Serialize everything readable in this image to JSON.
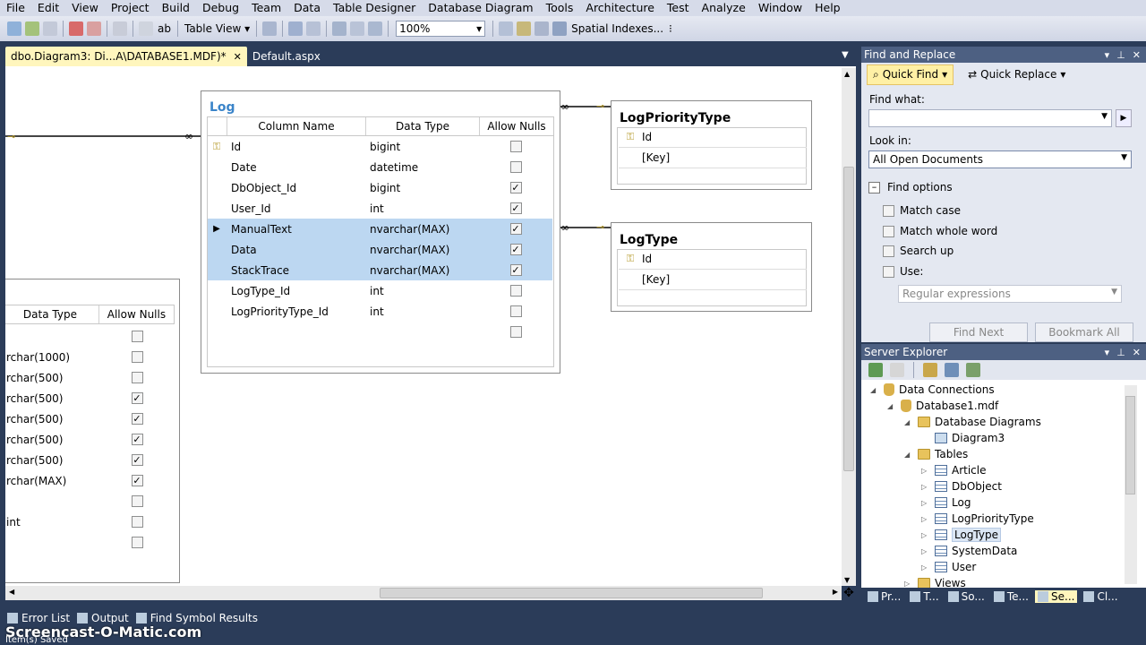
{
  "menu": [
    "File",
    "Edit",
    "View",
    "Project",
    "Build",
    "Debug",
    "Team",
    "Data",
    "Table Designer",
    "Database Diagram",
    "Tools",
    "Architecture",
    "Test",
    "Analyze",
    "Window",
    "Help"
  ],
  "toolbar": {
    "ab": "ab",
    "table_view": "Table View",
    "zoom": "100%",
    "spatial": "Spatial Indexes..."
  },
  "tabs": [
    {
      "label": "dbo.Diagram3: Di...A\\DATABASE1.MDF)*",
      "close": "✕"
    },
    {
      "label": "Default.aspx"
    }
  ],
  "log_table": {
    "title": "Log",
    "headers": [
      "Column Name",
      "Data Type",
      "Allow Nulls"
    ],
    "rows": [
      {
        "name": "Id",
        "type": "bigint",
        "nulls": false,
        "key": true
      },
      {
        "name": "Date",
        "type": "datetime",
        "nulls": false
      },
      {
        "name": "DbObject_Id",
        "type": "bigint",
        "nulls": true
      },
      {
        "name": "User_Id",
        "type": "int",
        "nulls": true
      },
      {
        "name": "ManualText",
        "type": "nvarchar(MAX)",
        "nulls": true,
        "selected": true,
        "current": true
      },
      {
        "name": "Data",
        "type": "nvarchar(MAX)",
        "nulls": true,
        "selected": true
      },
      {
        "name": "StackTrace",
        "type": "nvarchar(MAX)",
        "nulls": true,
        "selected": true
      },
      {
        "name": "LogType_Id",
        "type": "int",
        "nulls": false
      },
      {
        "name": "LogPriorityType_Id",
        "type": "int",
        "nulls": false
      },
      {
        "name": "",
        "type": "",
        "nulls": false
      }
    ]
  },
  "left_table": {
    "headers": [
      "Data Type",
      "Allow Nulls"
    ],
    "rows": [
      {
        "type": "",
        "nulls": false
      },
      {
        "type": "rchar(1000)",
        "nulls": false
      },
      {
        "type": "rchar(500)",
        "nulls": false
      },
      {
        "type": "rchar(500)",
        "nulls": true
      },
      {
        "type": "rchar(500)",
        "nulls": true
      },
      {
        "type": "rchar(500)",
        "nulls": true
      },
      {
        "type": "rchar(500)",
        "nulls": true
      },
      {
        "type": "rchar(MAX)",
        "nulls": true
      },
      {
        "type": "",
        "nulls": false
      },
      {
        "type": "int",
        "nulls": false
      },
      {
        "type": "",
        "nulls": false
      }
    ]
  },
  "logpriority_table": {
    "title": "LogPriorityType",
    "rows": [
      "Id",
      "[Key]"
    ]
  },
  "logtype_table": {
    "title": "LogType",
    "rows": [
      "Id",
      "[Key]"
    ]
  },
  "find_replace": {
    "title": "Find and Replace",
    "quick_find": "Quick Find",
    "quick_replace": "Quick Replace",
    "find_what": "Find what:",
    "look_in": "Look in:",
    "look_in_value": "All Open Documents",
    "find_options": "Find options",
    "options": [
      "Match case",
      "Match whole word",
      "Search up",
      "Use:"
    ],
    "use_value": "Regular expressions",
    "find_next": "Find Next",
    "bookmark_all": "Bookmark All"
  },
  "server_explorer": {
    "title": "Server Explorer",
    "items": [
      {
        "label": "Data Connections",
        "level": 0,
        "icon": "db",
        "arrow": "expanded"
      },
      {
        "label": "Database1.mdf",
        "level": 1,
        "icon": "db",
        "arrow": "expanded"
      },
      {
        "label": "Database Diagrams",
        "level": 2,
        "icon": "folder",
        "arrow": "expanded"
      },
      {
        "label": "Diagram3",
        "level": 3,
        "icon": "diag",
        "arrow": "none"
      },
      {
        "label": "Tables",
        "level": 2,
        "icon": "folder",
        "arrow": "expanded"
      },
      {
        "label": "Article",
        "level": 3,
        "icon": "table",
        "arrow": "collapsed"
      },
      {
        "label": "DbObject",
        "level": 3,
        "icon": "table",
        "arrow": "collapsed"
      },
      {
        "label": "Log",
        "level": 3,
        "icon": "table",
        "arrow": "collapsed"
      },
      {
        "label": "LogPriorityType",
        "level": 3,
        "icon": "table",
        "arrow": "collapsed"
      },
      {
        "label": "LogType",
        "level": 3,
        "icon": "table",
        "arrow": "collapsed",
        "selected": true
      },
      {
        "label": "SystemData",
        "level": 3,
        "icon": "table",
        "arrow": "collapsed"
      },
      {
        "label": "User",
        "level": 3,
        "icon": "table",
        "arrow": "collapsed"
      },
      {
        "label": "Views",
        "level": 2,
        "icon": "folder",
        "arrow": "collapsed"
      }
    ]
  },
  "bottom_right_tabs": [
    "Pr...",
    "T...",
    "So...",
    "Te...",
    "Se...",
    "Cl..."
  ],
  "output_tabs": [
    "Error List",
    "Output",
    "Find Symbol Results"
  ],
  "watermark": "Screencast-O-Matic.com",
  "status": "Item(s) Saved",
  "colors": {
    "selected_row": "#bcd7f1",
    "title_blue": "#3a84c9",
    "chrome": "#2b3c59"
  }
}
